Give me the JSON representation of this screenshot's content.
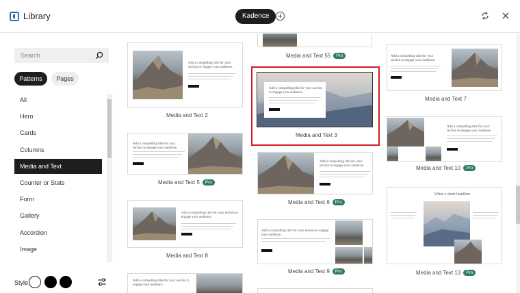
{
  "header": {
    "title": "Library",
    "active_source": "Kadence"
  },
  "sidebar": {
    "search_placeholder": "Search",
    "tabs": [
      "Patterns",
      "Pages"
    ],
    "categories": [
      "All",
      "Hero",
      "Cards",
      "Columns",
      "Media and Text",
      "Counter or Stats",
      "Form",
      "Gallery",
      "Accordion",
      "Image"
    ],
    "active_category": "Media and Text",
    "style_label": "Style"
  },
  "patterns": [
    {
      "label": "Media and Text 2",
      "pro": false
    },
    {
      "label": "Media and Text 5",
      "pro": true
    },
    {
      "label": "Media and Text 8",
      "pro": false
    },
    {
      "label": "Media and Text 55",
      "pro": true
    },
    {
      "label": "Media and Text 3",
      "pro": false,
      "selected": true
    },
    {
      "label": "Media and Text 6",
      "pro": true
    },
    {
      "label": "Media and Text 9",
      "pro": true
    },
    {
      "label": "Media and Text 7",
      "pro": false
    },
    {
      "label": "Media and Text 10",
      "pro": true
    },
    {
      "label": "Media and Text 13",
      "pro": true
    }
  ],
  "preview": {
    "headline": "Add a compelling title for your section to engage your audience.",
    "short_headline": "Write a short headline",
    "pro_badge": "Pro"
  },
  "colors": {
    "accent": "#1e1e1e",
    "pro_badge": "#2e7d5b",
    "selection": "#d01c1c"
  }
}
